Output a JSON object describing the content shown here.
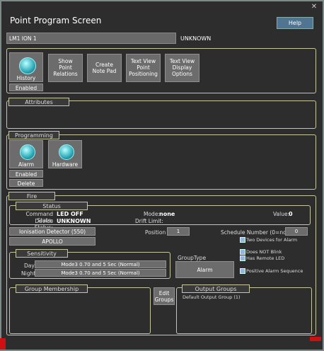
{
  "window": {
    "title": "Point Program Screen",
    "help_label": "Help",
    "close_label": "✕"
  },
  "point": {
    "name": "LM1 ION 1",
    "state": "UNKNOWN"
  },
  "top_tiles": [
    {
      "label": "History",
      "status": "Enabled"
    },
    {
      "label": "Show\nPoint\nRelations"
    },
    {
      "label": "Create\nNote Pad"
    },
    {
      "label": "Text View\nPoint\nPositioning"
    },
    {
      "label": "Text View\nDisplay\nOptions"
    }
  ],
  "attributes": {
    "legend": "Attributes"
  },
  "programming": {
    "legend": "Programming",
    "alarm": {
      "label": "Alarm",
      "status": "Enabled",
      "delete_label": "Delete"
    },
    "hardware": {
      "label": "Hardware"
    }
  },
  "fire": {
    "legend": "Fire",
    "status": {
      "legend": "Status",
      "command_state_label": "Command State:",
      "command_state_value": "LED OFF",
      "device_status_label": "Device Status:",
      "device_status_value": "UNKNOWN",
      "mode_label": "Mode:",
      "mode_value": "none",
      "drift_label": "Drift Limit:",
      "value_label": "Value:",
      "value_value": "0"
    },
    "detector": "Ionisation Detector (550)",
    "brand": "APOLLO",
    "position_label": "Position",
    "position_value": "1",
    "schedule_label": "Schedule Number (0=none)",
    "schedule_value": "0",
    "two_devices_label": "Two Devices for Alarm",
    "does_not_blink_label": "Does NOT Blink",
    "remote_led_label": "Has Remote LED",
    "positive_alarm_label": "Positive Alarm Sequence",
    "sensitivity": {
      "legend": "Sensitivity",
      "day_label": "Day",
      "day_value": "Mode3 0.70 and  5 Sec (Normal)",
      "night_label": "Night",
      "night_value": "Mode3 0.70 and  5 Sec (Normal)"
    },
    "group_type_label": "GroupType",
    "group_type_value": "Alarm",
    "group_membership_legend": "Group Membership",
    "edit_groups_label": "Edit\nGroups",
    "output_groups_legend": "Output Groups",
    "output_groups_items": [
      "Default Output Group (1)"
    ]
  },
  "colors": {
    "background": "#2d2d2d",
    "tile": "#6c6c6c",
    "accent": "#4f7593",
    "border": "#c8c8a0"
  }
}
